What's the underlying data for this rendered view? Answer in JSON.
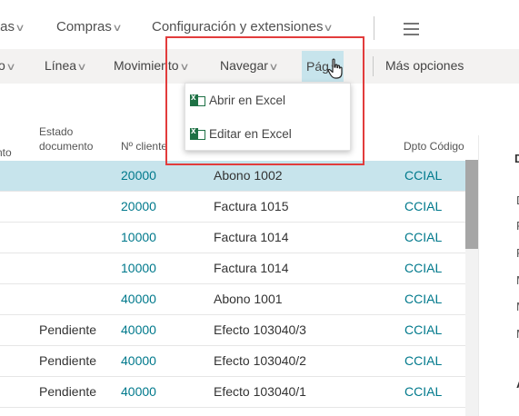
{
  "topbar": {
    "items": [
      {
        "label": "tas"
      },
      {
        "label": "Compras"
      },
      {
        "label": "Configuración y extensiones"
      }
    ]
  },
  "actionbar": {
    "items": [
      {
        "label": "o"
      },
      {
        "label": "Línea"
      },
      {
        "label": "Movimiento"
      },
      {
        "label": "Navegar"
      },
      {
        "label": "Pág"
      },
      {
        "label": "Más opciones"
      }
    ]
  },
  "page_menu": {
    "items": [
      {
        "label": "Abrir en Excel",
        "icon": "excel-icon"
      },
      {
        "label": "Editar en Excel",
        "icon": "excel-edit-icon"
      }
    ]
  },
  "table": {
    "headers": {
      "col0": "nto",
      "estado_line1": "Estado",
      "estado_line2": "documento",
      "cliente": "Nº cliente",
      "dpto": "Dpto Código"
    },
    "rows": [
      {
        "estado": "",
        "cliente": "20000",
        "descripcion": "Abono 1002",
        "dpto": "CCIAL",
        "selected": true
      },
      {
        "estado": "",
        "cliente": "20000",
        "descripcion": "Factura 1015",
        "dpto": "CCIAL"
      },
      {
        "estado": "",
        "cliente": "10000",
        "descripcion": "Factura 1014",
        "dpto": "CCIAL"
      },
      {
        "estado": "",
        "cliente": "10000",
        "descripcion": "Factura 1014",
        "dpto": "CCIAL"
      },
      {
        "estado": "",
        "cliente": "40000",
        "descripcion": "Abono 1001",
        "dpto": "CCIAL"
      },
      {
        "estado": "Pendiente",
        "cliente": "40000",
        "descripcion": "Efecto 103040/3",
        "dpto": "CCIAL"
      },
      {
        "estado": "Pendiente",
        "cliente": "40000",
        "descripcion": "Efecto 103040/2",
        "dpto": "CCIAL"
      },
      {
        "estado": "Pendiente",
        "cliente": "40000",
        "descripcion": "Efecto 103040/1",
        "dpto": "CCIAL"
      }
    ]
  },
  "factbox": {
    "letters": [
      "D",
      "D",
      "F",
      "F",
      "M",
      "M",
      "M",
      "A"
    ]
  },
  "colors": {
    "selection": "#c7e4ec",
    "link": "#00798c",
    "highlight_box": "#e23c3c",
    "excel_green": "#1e7145"
  }
}
